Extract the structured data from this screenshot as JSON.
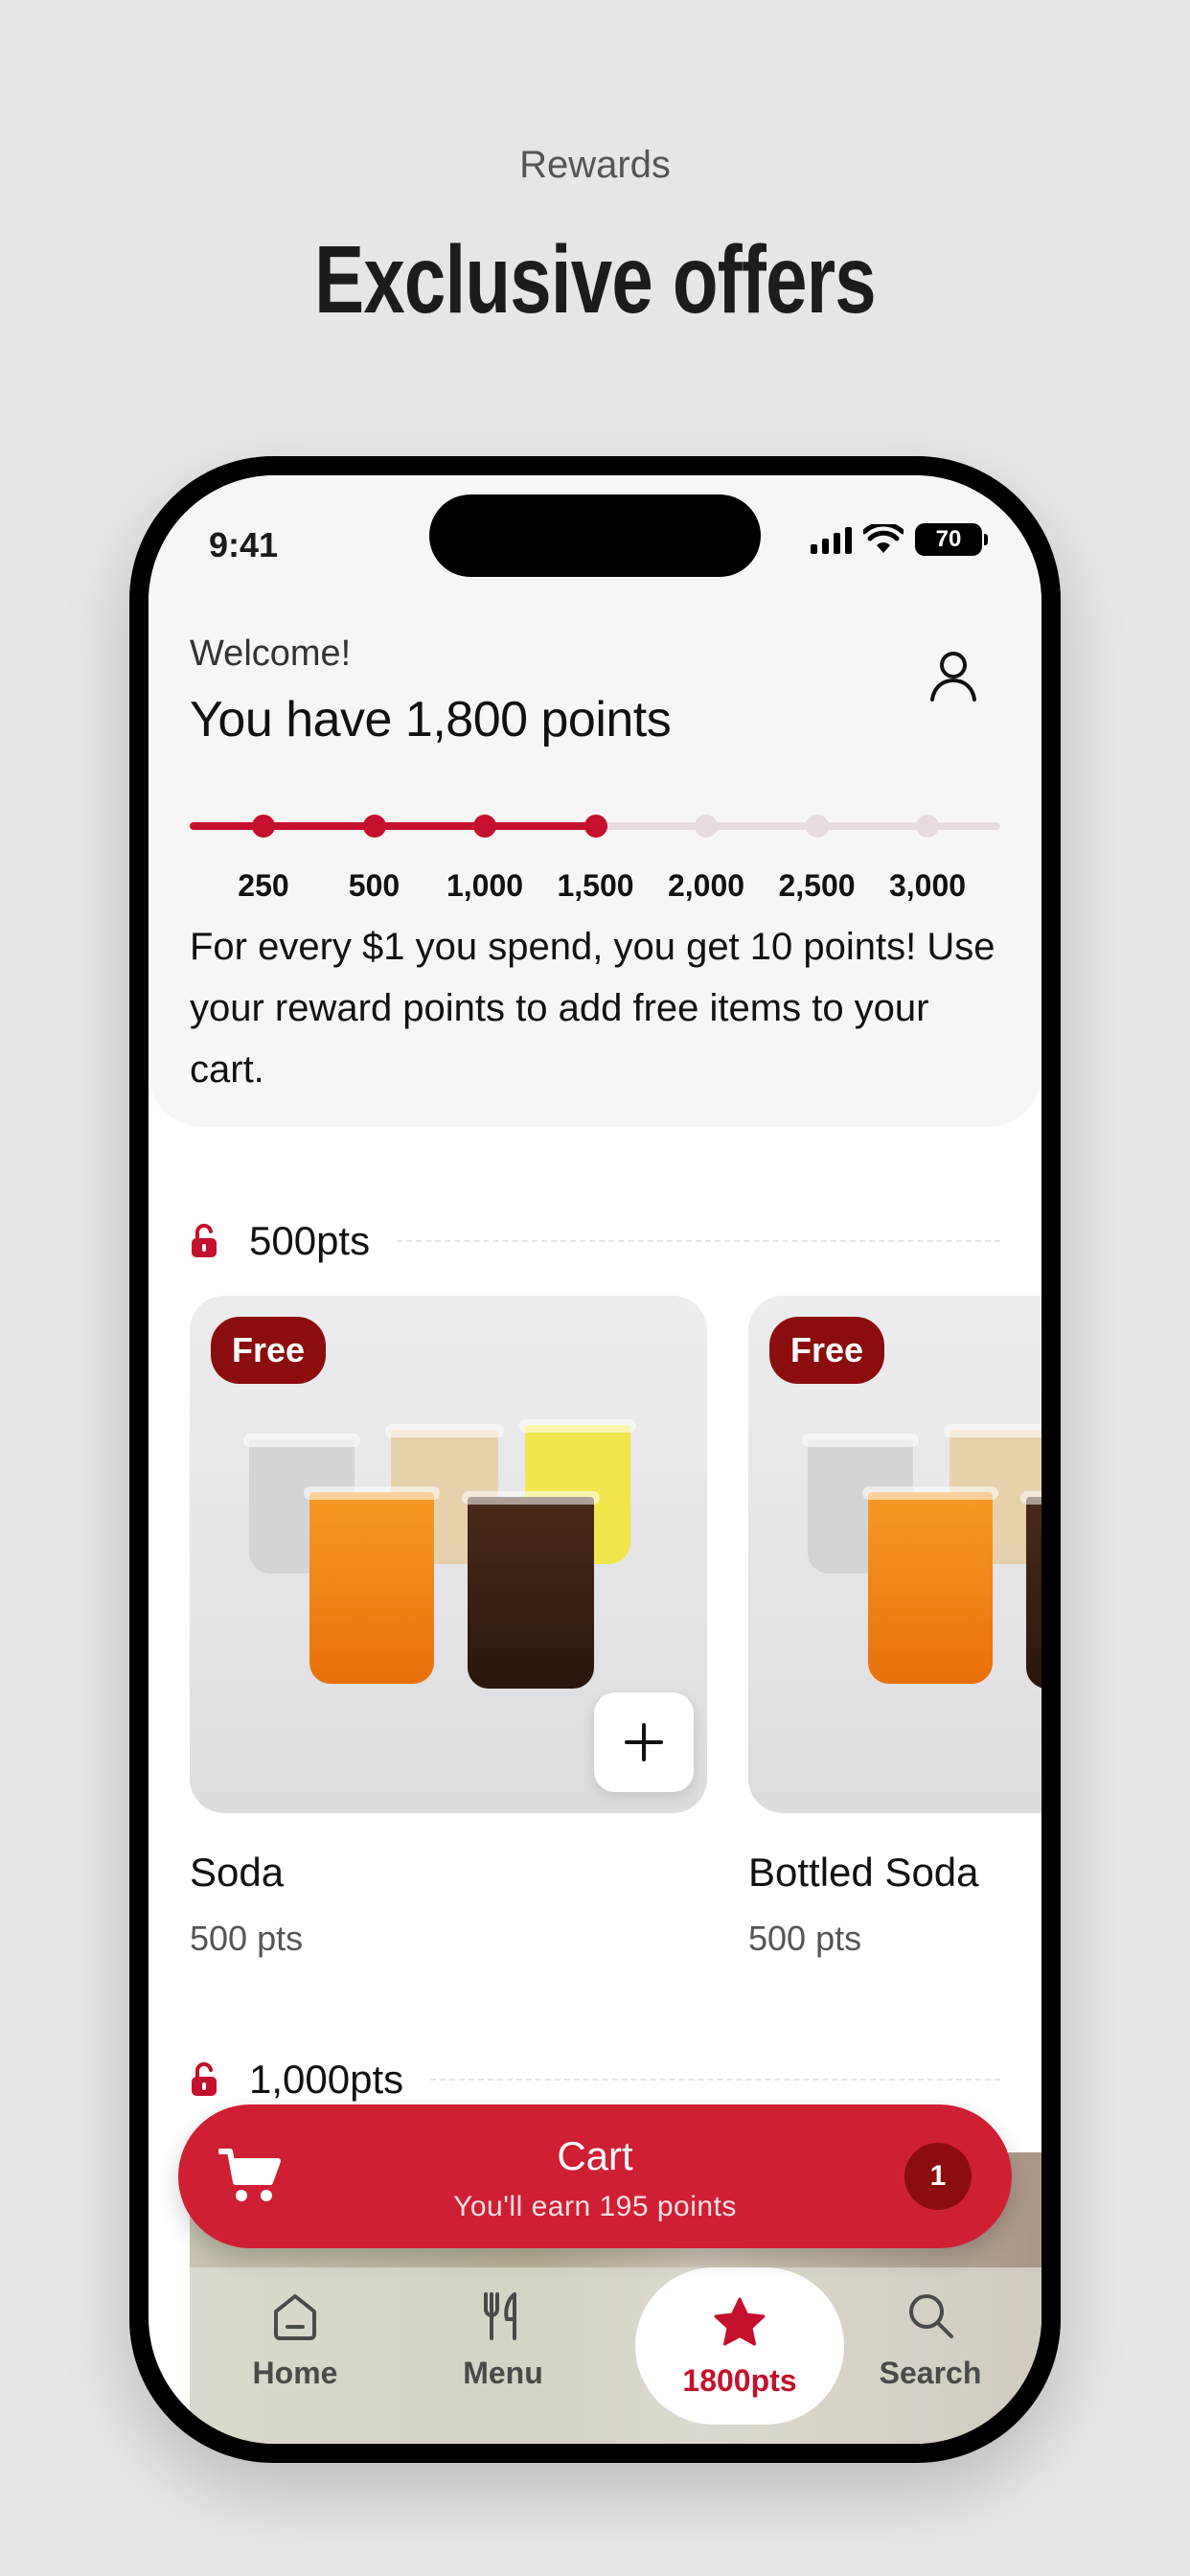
{
  "header": {
    "eyebrow": "Rewards",
    "headline": "Exclusive offers"
  },
  "status_bar": {
    "time": "9:41",
    "battery": "70"
  },
  "rewards": {
    "welcome": "Welcome!",
    "points_title": "You have 1,800 points",
    "progress_fraction": 0.5,
    "milestones": [
      {
        "label": "250",
        "reached": true
      },
      {
        "label": "500",
        "reached": true
      },
      {
        "label": "1,000",
        "reached": true
      },
      {
        "label": "1,500",
        "reached": true
      },
      {
        "label": "2,000",
        "reached": false
      },
      {
        "label": "2,500",
        "reached": false
      },
      {
        "label": "3,000",
        "reached": false
      }
    ],
    "info_line1": "For every $1 you spend, you get 10 points!",
    "info_line2": "Use your reward points to add free items to your cart."
  },
  "tiers": [
    {
      "label": "500pts"
    },
    {
      "label": "1,000pts"
    }
  ],
  "items": [
    {
      "badge": "Free",
      "name": "Soda",
      "points": "500 pts"
    },
    {
      "badge": "Free",
      "name": "Bottled Soda",
      "points": "500 pts"
    }
  ],
  "cart": {
    "title": "Cart",
    "subtitle": "You'll earn 195 points",
    "count": "1"
  },
  "tabbar": [
    {
      "label": "Home",
      "icon": "home-icon"
    },
    {
      "label": "Menu",
      "icon": "utensils-icon"
    },
    {
      "label": "1800pts",
      "icon": "star-icon",
      "active": true
    },
    {
      "label": "Search",
      "icon": "search-icon"
    }
  ],
  "colors": {
    "accent": "#c4102d",
    "cart": "#cf1f33",
    "badge": "#8b0d0d",
    "track": "#e6dcdc"
  }
}
